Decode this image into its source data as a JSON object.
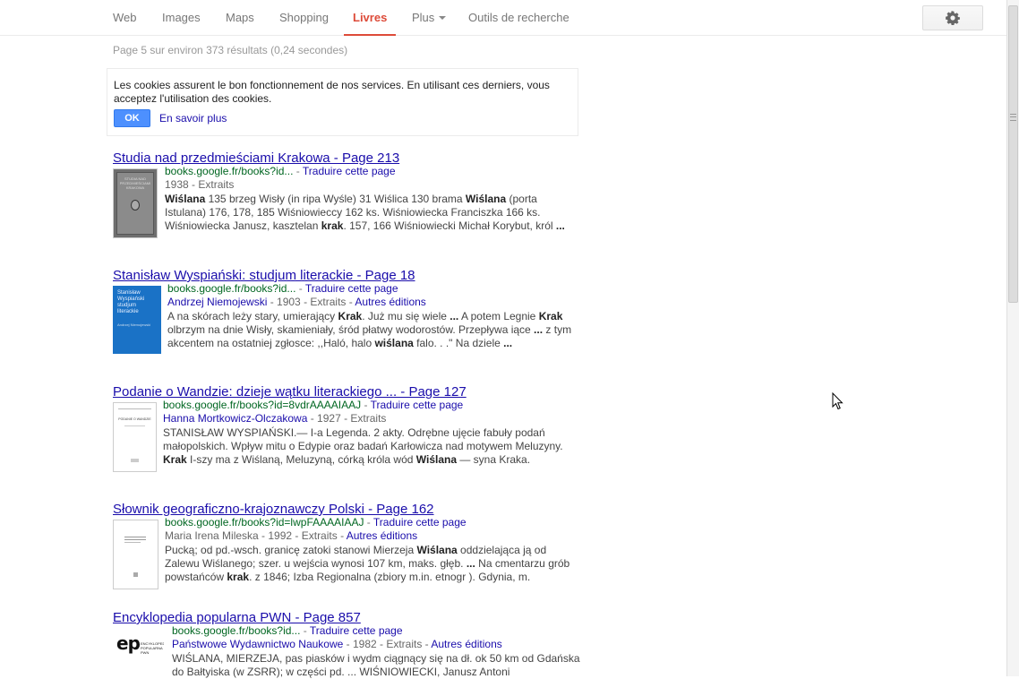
{
  "nav": {
    "tabs": [
      {
        "label": "Web"
      },
      {
        "label": "Images"
      },
      {
        "label": "Maps"
      },
      {
        "label": "Shopping"
      },
      {
        "label": "Livres",
        "active": true
      },
      {
        "label": "Plus"
      },
      {
        "label": "Outils de recherche"
      }
    ],
    "settings_icon": "gear-icon"
  },
  "stats": "Page 5 sur environ 373 résultats (0,24 secondes)",
  "cookie": {
    "text": "Les cookies assurent le bon fonctionnement de nos services. En utilisant ces derniers, vous acceptez l'utilisation des cookies.",
    "ok_label": "OK",
    "learn_more": "En savoir plus"
  },
  "results": [
    {
      "title": "Studia nad przedmieściami Krakowa - Page 213",
      "url": "books.google.fr/books?id...",
      "translate": "Traduire cette page",
      "author": "",
      "meta": "1938 - Extraits",
      "editions": "",
      "snippet": "<b>Wiślana</b> 135 brzeg Wisły (in ripa Wyśle) 31 Wiślica 130 brama <b>Wiślana</b> (porta Istulana) 176, 178, 185 Wiśniowieccy 162 ks. Wiśniowiecka Franciszka 166 ks. Wiśniowiecka Janusz, kasztelan <b>krak</b>. 157, 166 Wiśniowiecki Michał Korybut, król <b>...</b>"
    },
    {
      "title": "Stanisław Wyspiański: studjum literackie - Page 18",
      "url": "books.google.fr/books?id...",
      "translate": "Traduire cette page",
      "author": "Andrzej Niemojewski",
      "meta": " - 1903 - Extraits - ",
      "editions": "Autres éditions",
      "snippet": "A na skórach leży stary, umierający <b>Krak</b>. Już mu się wiele <b>...</b> A potem Legnie <b>Krak</b> olbrzym na dnie Wisły, skamieniały, śród płatwy wodorostów. Przepływa iące <b>...</b> z tym akcentem na ostatniej zgłosce: ,,Haló, halo <b>wiślana</b> falo. . .\" Na dziele <b>...</b>"
    },
    {
      "title": "Podanie o Wandzie: dzieje wątku literackiego ... - Page 127",
      "url": "books.google.fr/books?id=8vdrAAAAIAAJ",
      "translate": "Traduire cette page",
      "author": "Hanna Mortkowicz-Olczakowa",
      "meta": " - 1927 - Extraits",
      "editions": "",
      "snippet": "STANISŁAW WYSPIAŃSKI.— I-a Legenda. 2 akty. Odrębne ujęcie fabuły podań małopolskich. Wpływ mitu o Edypie oraz badań Karłowicza nad motywem Meluzyny. <b>Krak</b> I-szy ma z Wiślaną, Meluzyną, córką króla wód <b>Wiślana</b> — syna Kraka."
    },
    {
      "title": "Słownik geograficzno-krajoznawczy Polski - Page 162",
      "url": "books.google.fr/books?id=lwpFAAAAIAAJ",
      "translate": "Traduire cette page",
      "author": "",
      "meta": "Maria Irena Mileska - 1992 - Extraits - ",
      "editions": "Autres éditions",
      "snippet": "Pucką; od pd.-wsch. granicę zatoki stanowi Mierzeja <b>Wiślana</b> oddzielająca ją od Zalewu Wiślanego; szer. u wejścia wynosi 107 km, maks. głęb. <b>...</b> Na cmentarzu grób powstańców <b>krak</b>. z 1846; Izba Regionalna (zbiory m.in. etnogr ). Gdynia, m."
    },
    {
      "title": "Encyklopedia popularna PWN - Page 857",
      "url": "books.google.fr/books?id...",
      "translate": "Traduire cette page",
      "author": "Państwowe Wydawnictwo Naukowe",
      "meta": " - 1982 - Extraits - ",
      "editions": "Autres éditions",
      "snippet": "WIŚLANA, MIERZEJA, pas piasków i wydm ciągnący się na dł. ok 50 km od Gdańska do Bałtyiska (w ZSRR); w części pd. ... WIŚNIOWIECKI, Janusz Antoni"
    }
  ],
  "thumbs": [
    {
      "text": "STUDIA NAD PRZEDMIEŚCIAMI KRAKOWA"
    },
    {
      "text": "Stanisław Wyspiański studjum literackie",
      "sub": "Andrzej Niemojewski"
    },
    {
      "text": "PODANIE O WANDZIE"
    },
    {
      "text": ""
    },
    {
      "text": "ep",
      "sub": "ENCYKLOPEDIA POPULARNA PWN"
    }
  ]
}
